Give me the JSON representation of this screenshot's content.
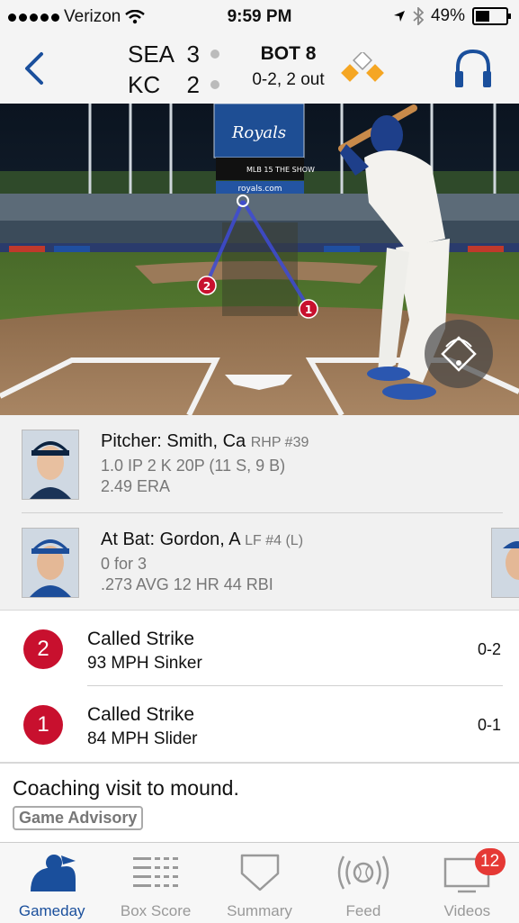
{
  "status_bar": {
    "carrier": "Verizon",
    "time": "9:59 PM",
    "battery": "49%"
  },
  "scoreboard": {
    "away": {
      "team": "SEA",
      "runs": "3"
    },
    "home": {
      "team": "KC",
      "runs": "2"
    },
    "inning": "BOT 8",
    "count": "0-2, 2 out"
  },
  "field": {
    "scoreboard_text": "Royals",
    "site": "royals.com",
    "ad": "MLB 15 THE SHOW",
    "pitch_markers": [
      "2",
      "1"
    ]
  },
  "pitcher": {
    "title": "Pitcher: Smith, Ca",
    "sub": "RHP #39",
    "line1": "1.0 IP  2 K  20P (11 S, 9 B)",
    "line2": "2.49 ERA"
  },
  "batter": {
    "title": "At Bat: Gordon, A",
    "sub": "LF #4 (L)",
    "line1": "0 for 3",
    "line2": ".273 AVG  12 HR  44 RBI"
  },
  "pitches": [
    {
      "num": "2",
      "result": "Called Strike",
      "detail": "93 MPH Sinker",
      "count": "0-2"
    },
    {
      "num": "1",
      "result": "Called Strike",
      "detail": "84 MPH Slider",
      "count": "0-1"
    }
  ],
  "advisory": {
    "text": "Coaching visit to mound.",
    "badge": "Game Advisory"
  },
  "tabs": [
    {
      "label": "Gameday",
      "icon": "gameday-icon"
    },
    {
      "label": "Box Score",
      "icon": "box-score-icon"
    },
    {
      "label": "Summary",
      "icon": "summary-icon"
    },
    {
      "label": "Feed",
      "icon": "feed-icon"
    },
    {
      "label": "Videos",
      "icon": "videos-icon",
      "badge": "12"
    }
  ],
  "colors": {
    "accent": "#1a4f9c",
    "ball": "#c8102e",
    "base": "#f5a623",
    "badge": "#e53935"
  }
}
